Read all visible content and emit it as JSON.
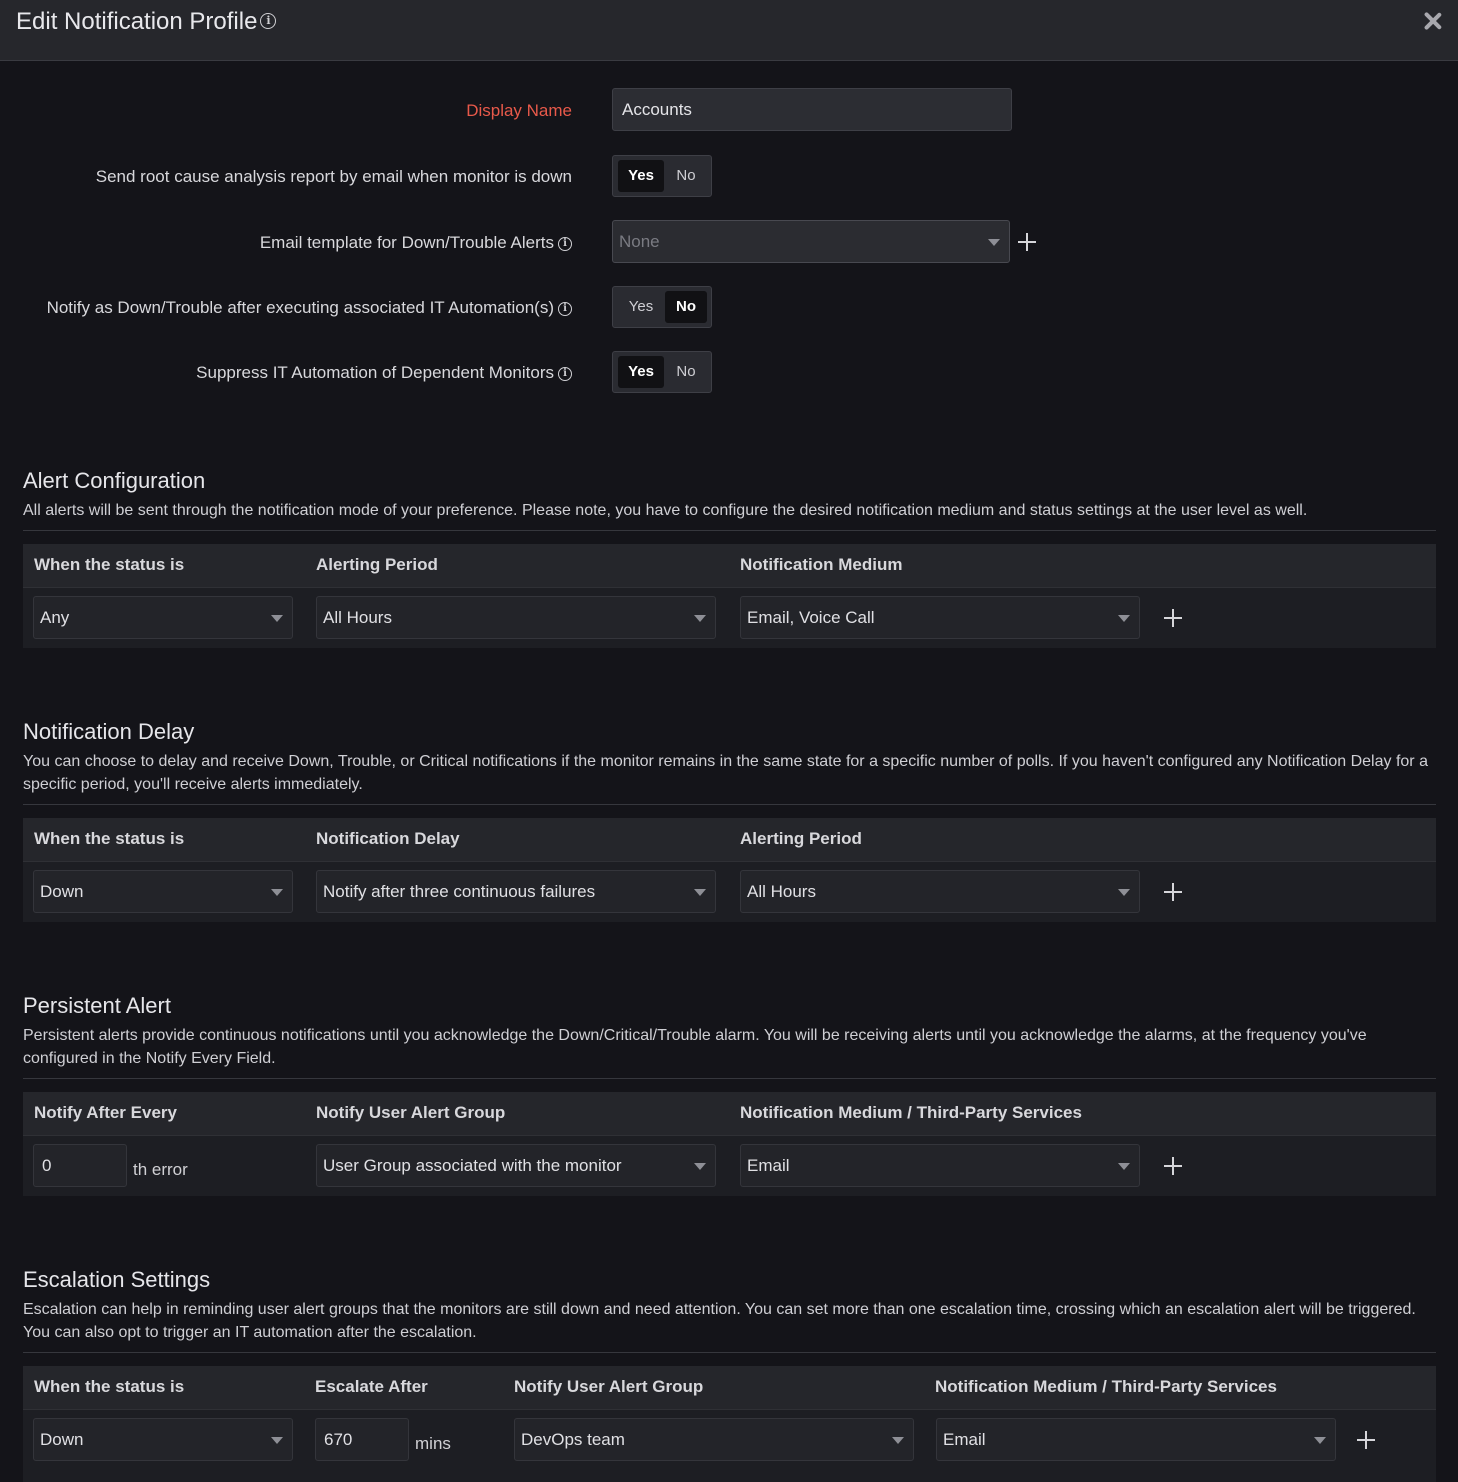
{
  "header": {
    "title": "Edit Notification Profile"
  },
  "form": {
    "display_name_label": "Display Name",
    "display_name_value": "Accounts",
    "rca_label": "Send root cause analysis report by email when monitor is down",
    "email_template_label": "Email template for Down/Trouble Alerts",
    "email_template_value": "None",
    "notify_after_automation_label": "Notify as Down/Trouble after executing associated IT Automation(s)",
    "suppress_label": "Suppress IT Automation of Dependent Monitors",
    "yes": "Yes",
    "no": "No",
    "rca_selected": "Yes",
    "notify_after_automation_selected": "No",
    "suppress_selected": "Yes"
  },
  "alert_config": {
    "title": "Alert Configuration",
    "description": "All alerts will be sent through the notification mode of your preference. Please note, you have to configure the desired notification medium and status settings at the user level as well.",
    "headers": [
      "When the status is",
      "Alerting Period",
      "Notification Medium"
    ],
    "status": "Any",
    "period": "All Hours",
    "medium": "Email, Voice Call"
  },
  "notification_delay": {
    "title": "Notification Delay",
    "description": "You can choose to delay and receive Down, Trouble, or Critical notifications if the monitor remains in the same state for a specific number of polls. If you haven't configured any Notification Delay for a specific period, you'll receive alerts immediately.",
    "headers": [
      "When the status is",
      "Notification Delay",
      "Alerting Period"
    ],
    "status": "Down",
    "delay": "Notify after three continuous failures",
    "period": "All Hours"
  },
  "persistent_alert": {
    "title": "Persistent Alert",
    "description": "Persistent alerts provide continuous notifications until you acknowledge the Down/Critical/Trouble alarm. You will be receiving alerts until you acknowledge the alarms, at the frequency you've configured in the Notify Every Field.",
    "headers": [
      "Notify After Every",
      "Notify User Alert Group",
      "Notification Medium / Third-Party Services"
    ],
    "every_value": "0",
    "every_suffix": "th error",
    "group": "User Group associated with the monitor",
    "medium": "Email"
  },
  "escalation": {
    "title": "Escalation Settings",
    "description": "Escalation can help in reminding user alert groups that the monitors are still down and need attention. You can set more than one escalation time, crossing which an escalation alert will be triggered. You can also opt to trigger an IT automation after the escalation.",
    "headers": [
      "When the status is",
      "Escalate After",
      "Notify User Alert Group",
      "Notification Medium / Third-Party Services"
    ],
    "status": "Down",
    "after_value": "670",
    "after_suffix": "mins",
    "group": "DevOps team",
    "medium": "Email"
  }
}
